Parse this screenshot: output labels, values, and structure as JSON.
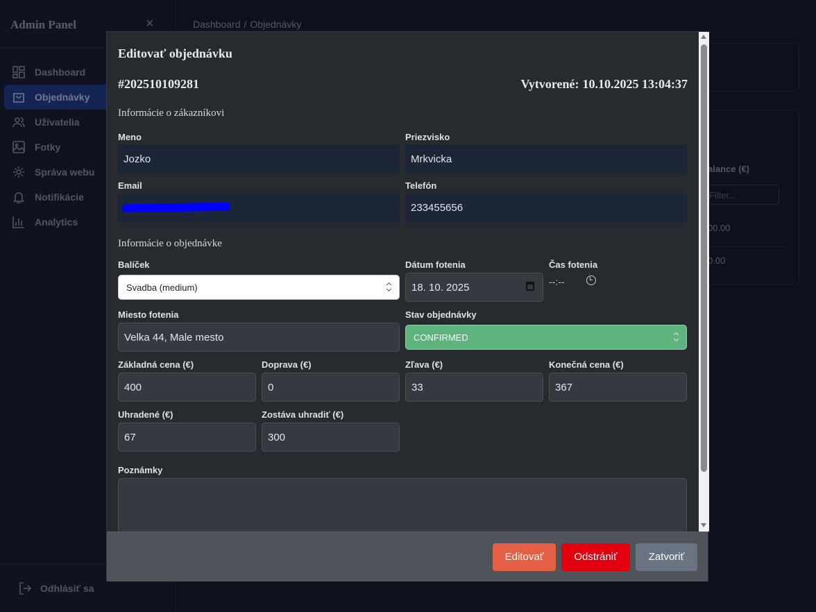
{
  "sidebar": {
    "title": "Admin Panel",
    "close_icon": "×",
    "items": [
      {
        "label": "Dashboard",
        "icon": "dashboard-icon"
      },
      {
        "label": "Objednávky",
        "icon": "shopping-bag-icon",
        "active": true
      },
      {
        "label": "Užívatelia",
        "icon": "users-icon"
      },
      {
        "label": "Fotky",
        "icon": "image-icon"
      },
      {
        "label": "Správa webu",
        "icon": "gear-icon"
      },
      {
        "label": "Notifikácie",
        "icon": "bell-icon"
      },
      {
        "label": "Analytics",
        "icon": "chart-icon"
      }
    ],
    "logout": "Odhlásiť sa"
  },
  "breadcrumb": {
    "root": "Dashboard",
    "sep": "/",
    "current": "Objednávky"
  },
  "background": {
    "column_header": "alance (€)",
    "filter_placeholder": "Filter...",
    "values": [
      "00.00",
      "0.00"
    ]
  },
  "modal": {
    "title": "Editovať objednávku",
    "order_number": "#202510109281",
    "created_label": "Vytvorené:",
    "created_value": "10.10.2025 13:04:37",
    "customer_section": "Informácie o zákazníkovi",
    "order_section": "Informácie o objednávke",
    "fields": {
      "meno": {
        "label": "Meno",
        "value": "Jozko"
      },
      "priezvisko": {
        "label": "Priezvisko",
        "value": "Mrkvicka"
      },
      "email": {
        "label": "Email",
        "value": ""
      },
      "telefon": {
        "label": "Telefón",
        "value": "233455656"
      },
      "balicek": {
        "label": "Balíček",
        "value": "Svadba (medium)"
      },
      "datum": {
        "label": "Dátum fotenia",
        "value": "18. 10. 2025"
      },
      "cas": {
        "label": "Čas fotenia",
        "value": "--:--"
      },
      "miesto": {
        "label": "Miesto fotenia",
        "value": "Velka 44, Male mesto"
      },
      "stav": {
        "label": "Stav objednávky",
        "value": "CONFIRMED"
      },
      "zakladna": {
        "label": "Základná cena (€)",
        "value": "400"
      },
      "doprava": {
        "label": "Doprava (€)",
        "value": "0"
      },
      "zlava": {
        "label": "Zľava (€)",
        "value": "33"
      },
      "konecna": {
        "label": "Konečná cena (€)",
        "value": "367"
      },
      "uhradene": {
        "label": "Uhradené (€)",
        "value": "67"
      },
      "zostava": {
        "label": "Zostáva uhradiť (€)",
        "value": "300"
      },
      "poznamky": {
        "label": "Poznámky",
        "value": ""
      }
    },
    "buttons": {
      "edit": "Editovať",
      "delete": "Odstrániť",
      "close": "Zatvoriť"
    }
  },
  "colors": {
    "accent": "#e35f45",
    "danger": "#e3000e",
    "status_confirmed": "#5fb37f",
    "active_nav": "#1e3a8a"
  }
}
